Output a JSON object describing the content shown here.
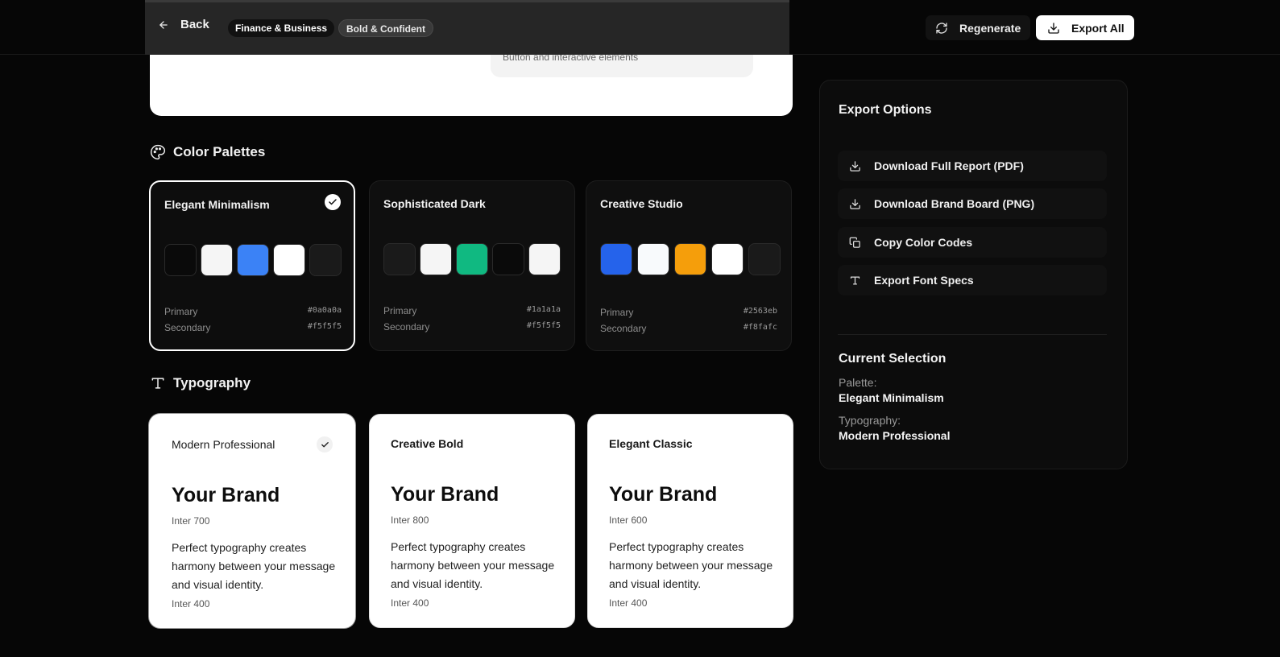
{
  "header": {
    "back_label": "Back",
    "tags": [
      "Finance & Business",
      "Bold & Confident"
    ],
    "regenerate_label": "Regenerate",
    "export_all_label": "Export All"
  },
  "hero": {
    "subtitle": "Button and interactive elements"
  },
  "palettes_section": {
    "title": "Color Palettes",
    "primary_label": "Primary",
    "secondary_label": "Secondary",
    "cards": [
      {
        "name": "Elegant Minimalism",
        "selected": true,
        "swatches": [
          "#0a0a0a",
          "#f5f5f5",
          "#3b82f6",
          "#ffffff",
          "#1a1a1a"
        ],
        "primary": "#0a0a0a",
        "secondary": "#f5f5f5"
      },
      {
        "name": "Sophisticated Dark",
        "selected": false,
        "swatches": [
          "#1a1a1a",
          "#f5f5f5",
          "#10b981",
          "#0a0a0a",
          "#f5f5f5"
        ],
        "primary": "#1a1a1a",
        "secondary": "#f5f5f5"
      },
      {
        "name": "Creative Studio",
        "selected": false,
        "swatches": [
          "#2563eb",
          "#f8fafc",
          "#f59e0b",
          "#ffffff",
          "#1a1a1a"
        ],
        "primary": "#2563eb",
        "secondary": "#f8fafc"
      }
    ]
  },
  "typography_section": {
    "title": "Typography",
    "brand_sample": "Your Brand",
    "body_sample": "Perfect typography creates harmony between your message and visual identity.",
    "body_weight": "Inter 400",
    "cards": [
      {
        "name": "Modern Professional",
        "weight": "Inter 700",
        "selected": true
      },
      {
        "name": "Creative Bold",
        "weight": "Inter 800",
        "selected": false
      },
      {
        "name": "Elegant Classic",
        "weight": "Inter 600",
        "selected": false
      }
    ]
  },
  "export_panel": {
    "title": "Export Options",
    "options": [
      {
        "label": "Download Full Report (PDF)",
        "icon": "download-icon"
      },
      {
        "label": "Download Brand Board (PNG)",
        "icon": "download-icon"
      },
      {
        "label": "Copy Color Codes",
        "icon": "copy-icon"
      },
      {
        "label": "Export Font Specs",
        "icon": "type-icon"
      }
    ],
    "current_title": "Current Selection",
    "palette_label": "Palette:",
    "palette_value": "Elegant Minimalism",
    "typography_label": "Typography:",
    "typography_value": "Modern Professional"
  }
}
